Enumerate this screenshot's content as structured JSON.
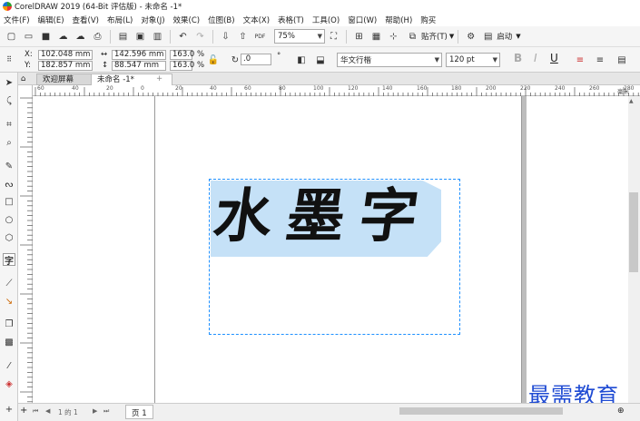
{
  "window": {
    "title": "CorelDRAW 2019 (64-Bit 评估版) - 未命名 -1*"
  },
  "menu": [
    "文件(F)",
    "编辑(E)",
    "查看(V)",
    "布局(L)",
    "对象(J)",
    "效果(C)",
    "位图(B)",
    "文本(X)",
    "表格(T)",
    "工具(O)",
    "窗口(W)",
    "帮助(H)",
    "购买"
  ],
  "toolbar": {
    "zoom": "75%",
    "snap_label": "贴齐(T)",
    "launch_label": "启动"
  },
  "property_bar": {
    "x_label": "X:",
    "x": "102.048 mm",
    "y_label": "Y:",
    "y": "182.857 mm",
    "w": "142.596 mm",
    "h": "88.547 mm",
    "sx": "163.0",
    "sy": "163.0",
    "pct": "%",
    "rotation": ".0",
    "deg": "°",
    "font": "华文行楷",
    "size": "120 pt",
    "bold": "B",
    "italic": "I",
    "underline": "U"
  },
  "tabs": {
    "welcome": "欢迎屏幕",
    "doc": "未命名 -1*",
    "add": "+"
  },
  "ruler_h_labels": [
    "60",
    "40",
    "20",
    "0",
    "20",
    "40",
    "60",
    "80",
    "100",
    "120",
    "140",
    "160",
    "180",
    "200",
    "220",
    "240",
    "260",
    "280"
  ],
  "ruler_unit": "毫米",
  "document": {
    "text": "水墨字"
  },
  "page_nav": {
    "counter": "1 的 1",
    "page_tab": "页 1"
  },
  "watermark": "最需教育",
  "colors": {
    "selection_fill": "#c5e1f7",
    "guide": "#1e90ff",
    "ink": "#111111"
  }
}
